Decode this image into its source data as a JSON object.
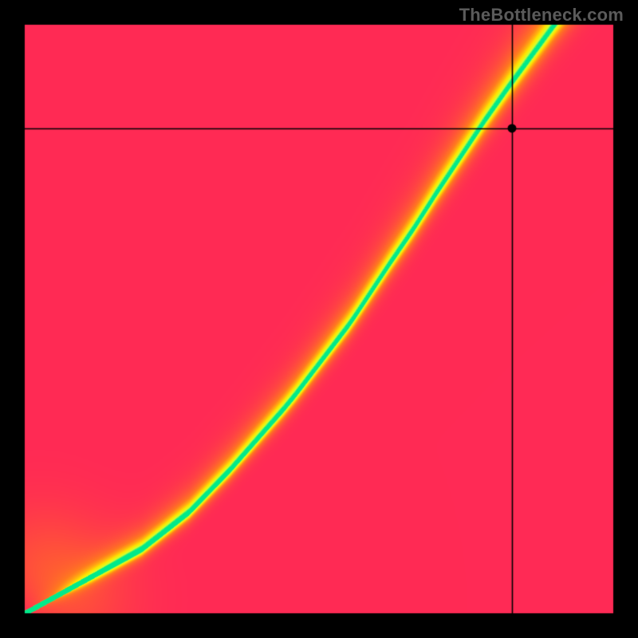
{
  "watermark": {
    "text": "TheBottleneck.com"
  },
  "chart_data": {
    "type": "heatmap",
    "title": "",
    "xlabel": "",
    "ylabel": "",
    "xlim": [
      0,
      1
    ],
    "ylim": [
      0,
      1
    ],
    "grid": false,
    "legend": false,
    "crosshair": {
      "x": 0.827,
      "y": 0.823
    },
    "marker": {
      "x": 0.827,
      "y": 0.823
    },
    "color_stops": [
      {
        "t": 0.0,
        "color": "#ff2a55"
      },
      {
        "t": 0.35,
        "color": "#ff7a1f"
      },
      {
        "t": 0.65,
        "color": "#ffe500"
      },
      {
        "t": 0.85,
        "color": "#d2ff33"
      },
      {
        "t": 1.0,
        "color": "#00e98b"
      }
    ],
    "ridge": {
      "lower": [
        {
          "x": 0.0,
          "y": 0.0
        },
        {
          "x": 0.2,
          "y": 0.12
        },
        {
          "x": 0.35,
          "y": 0.28
        },
        {
          "x": 0.46,
          "y": 0.42
        },
        {
          "x": 0.55,
          "y": 0.55
        },
        {
          "x": 0.62,
          "y": 0.67
        },
        {
          "x": 0.7,
          "y": 0.8
        },
        {
          "x": 0.78,
          "y": 0.92
        },
        {
          "x": 0.84,
          "y": 1.0
        }
      ],
      "upper": [
        {
          "x": 0.0,
          "y": 0.0
        },
        {
          "x": 0.28,
          "y": 0.14
        },
        {
          "x": 0.44,
          "y": 0.3
        },
        {
          "x": 0.56,
          "y": 0.44
        },
        {
          "x": 0.66,
          "y": 0.57
        },
        {
          "x": 0.74,
          "y": 0.69
        },
        {
          "x": 0.82,
          "y": 0.81
        },
        {
          "x": 0.9,
          "y": 0.92
        },
        {
          "x": 0.97,
          "y": 1.0
        }
      ]
    },
    "field": {
      "description": "Score 0..1 at (x,y) in [0,1]^2; high near ridge band, low away; plotted with y increasing upward.",
      "heat_resolution": 180
    }
  }
}
